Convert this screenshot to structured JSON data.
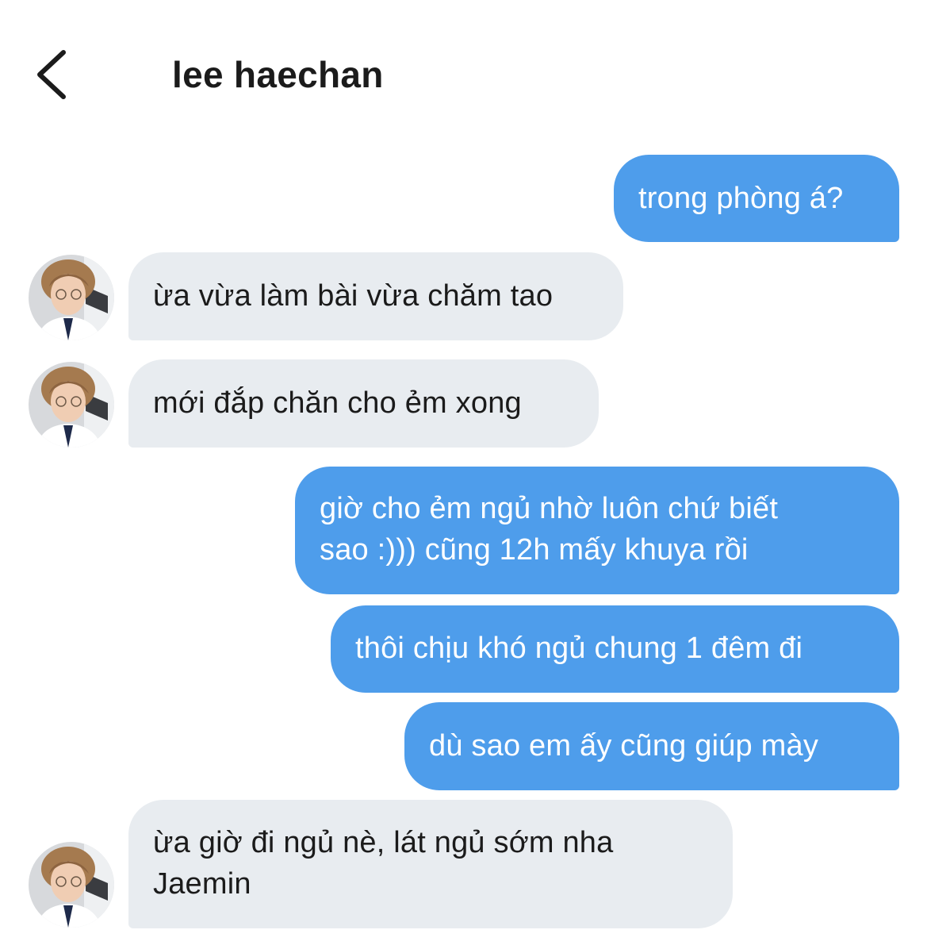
{
  "header": {
    "back_icon": "chevron-left-icon",
    "contact_name": "lee haechan"
  },
  "messages": [
    {
      "direction": "outgoing",
      "lines": [
        "trong phòng á?"
      ]
    },
    {
      "direction": "incoming",
      "lines": [
        "ừa vừa làm bài vừa chăm tao"
      ]
    },
    {
      "direction": "incoming",
      "lines": [
        "mới đắp chăn cho ẻm xong"
      ]
    },
    {
      "direction": "outgoing",
      "lines": [
        "giờ cho ẻm ngủ nhờ luôn chứ biết",
        "sao :))) cũng 12h mấy khuya rồi"
      ]
    },
    {
      "direction": "outgoing",
      "lines": [
        "thôi chịu khó ngủ chung 1 đêm đi"
      ]
    },
    {
      "direction": "outgoing",
      "lines": [
        "dù sao em ấy cũng giúp mày"
      ]
    },
    {
      "direction": "incoming",
      "lines": [
        "ừa giờ đi ngủ nè, lát ngủ sớm nha",
        "Jaemin"
      ]
    }
  ],
  "colors": {
    "outgoing_bubble": "#4e9deb",
    "incoming_bubble": "#e8ecf0",
    "text_dark": "#1b1b1b",
    "text_light": "#ffffff"
  }
}
